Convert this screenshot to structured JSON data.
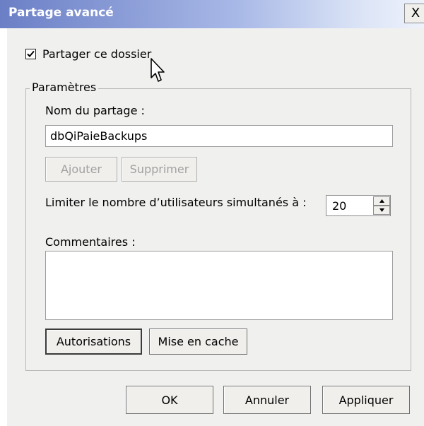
{
  "window": {
    "title": "Partage avancé",
    "close_glyph": "X"
  },
  "share_checkbox": {
    "label": "Partager ce dossier",
    "checked": true
  },
  "parameters": {
    "group_label": "Paramètres",
    "share_name_label": "Nom du partage :",
    "share_name_value": "dbQiPaieBackups",
    "add_label": "Ajouter",
    "remove_label": "Supprimer",
    "limit_label": "Limiter le nombre d’utilisateurs simultanés à :",
    "limit_value": "20",
    "comments_label": "Commentaires :",
    "comments_value": "",
    "permissions_label": "Autorisations",
    "caching_label": "Mise en cache"
  },
  "footer": {
    "ok_label": "OK",
    "cancel_label": "Annuler",
    "apply_label": "Appliquer"
  },
  "icons": {
    "checkmark": "check-icon",
    "spin_up": "arrow-up-icon",
    "spin_down": "arrow-down-icon",
    "cursor": "mouse-cursor-icon"
  },
  "colors": {
    "titlebar_start": "#6b7fc6",
    "titlebar_end": "#eef2fb",
    "dialog_bg": "#f0f0ef"
  }
}
